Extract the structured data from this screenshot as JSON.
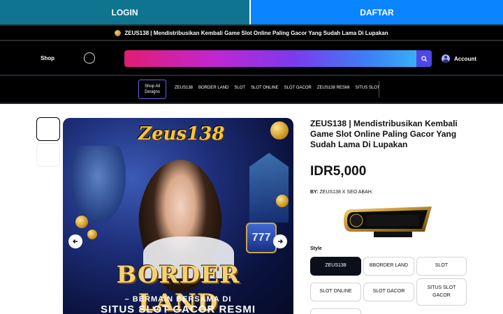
{
  "top_buttons": {
    "login": "LOGIN",
    "daftar": "DAFTAR"
  },
  "announcement": "ZEUS138 | Mendistribusikan Kembali Game Slot Online Paling Gacor Yang Sudah Lama Di Lupakan",
  "header": {
    "shop": "Shop",
    "account": "Account",
    "search_icon": "search-icon"
  },
  "nav": {
    "all_designs": "Shop All Designs",
    "items": [
      "ZEUS138",
      "BORDER LAND",
      "SLOT",
      "SLOT ONLINE",
      "SLOT GACOR",
      "ZEUS138 RESMI",
      "SITUS SLOT"
    ]
  },
  "hero": {
    "logo": "Zeus138",
    "banner": "BORDER LAND",
    "sub1": "– BERMAIN BERSAMA DI",
    "sub2": "SITUS SLOT GACOR RESMI",
    "slot_number": "777"
  },
  "product": {
    "title": "ZEUS138 | Mendistribusikan Kembali Game Slot Online Paling Gacor Yang Sudah Lama Di Lupakan",
    "price": "IDR5,000",
    "by_label": "BY:",
    "by_value": "ZEUS138 X SEO ABAH.",
    "style_label": "Style",
    "options": [
      "ZEUS138",
      "BBORDER LAND",
      "SLOT",
      "SLOT ONLINE",
      "SLOT GACOR",
      "SITUS SLOT GACOR"
    ],
    "selected_option": "ZEUS138"
  },
  "colors": {
    "login_bg": "#0e7490",
    "daftar_bg": "#0a84ff",
    "header_bg": "#000000",
    "selected_option_bg": "#0b0f1a"
  }
}
